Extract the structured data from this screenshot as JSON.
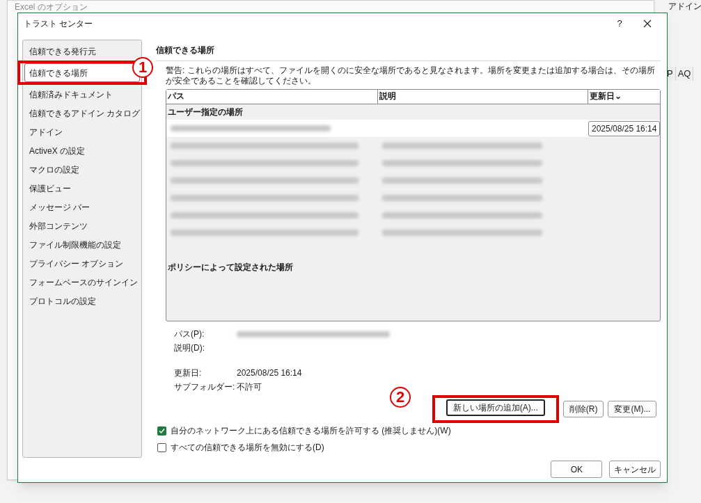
{
  "background": {
    "window_title": "Excel のオプション",
    "ribbon_label": "アドイン",
    "column_headers": [
      "P",
      "AQ"
    ]
  },
  "window": {
    "title": "トラスト センター",
    "help": "?"
  },
  "sidebar": {
    "items": [
      {
        "label": "信頼できる発行元",
        "selected": false
      },
      {
        "label": "信頼できる場所",
        "selected": true
      },
      {
        "label": "信頼済みドキュメント",
        "selected": false
      },
      {
        "label": "信頼できるアドイン カタログ",
        "selected": false
      },
      {
        "label": "アドイン",
        "selected": false
      },
      {
        "label": "ActiveX の設定",
        "selected": false
      },
      {
        "label": "マクロの設定",
        "selected": false
      },
      {
        "label": "保護ビュー",
        "selected": false
      },
      {
        "label": "メッセージ バー",
        "selected": false
      },
      {
        "label": "外部コンテンツ",
        "selected": false
      },
      {
        "label": "ファイル制限機能の設定",
        "selected": false
      },
      {
        "label": "プライバシー オプション",
        "selected": false
      },
      {
        "label": "フォームベースのサインイン",
        "selected": false
      },
      {
        "label": "プロトコルの設定",
        "selected": false
      }
    ]
  },
  "section": {
    "title": "信頼できる場所",
    "warning": "警告: これらの場所はすべて、ファイルを開くのに安全な場所であると見なされます。場所を変更または追加する場合は、その場所が安全であることを確認してください。"
  },
  "table": {
    "columns": [
      "パス",
      "説明",
      "更新日"
    ],
    "sort_indicator": "⌄",
    "groups": [
      {
        "title": "ユーザー指定の場所",
        "rows": [
          {
            "selected": true,
            "blurred_description": false,
            "modified": "2025/08/25 16:14"
          },
          {
            "selected": false,
            "blurred_description": true
          },
          {
            "selected": false,
            "blurred_description": true
          },
          {
            "selected": false,
            "blurred_description": true
          },
          {
            "selected": false,
            "blurred_description": true
          },
          {
            "selected": false,
            "blurred_description": true
          },
          {
            "selected": false,
            "blurred_description": true
          }
        ]
      },
      {
        "title": "ポリシーによって設定された場所"
      }
    ]
  },
  "details": [
    {
      "label": "パス(P):",
      "value_blurred": true
    },
    {
      "label": "説明(D):"
    },
    {
      "label": "更新日:",
      "value": "2025/08/25 16:14"
    },
    {
      "label": "サブフォルダー:",
      "value": "不許可"
    }
  ],
  "buttons": [
    {
      "label": "新しい場所の追加(A)...",
      "focused": true
    },
    {
      "label": "削除(R)",
      "focused": false
    },
    {
      "label": "変更(M)...",
      "focused": false
    }
  ],
  "checkboxes": [
    {
      "label": "自分のネットワーク上にある信頼できる場所を許可する (推奨しません)(W)",
      "checked": true
    },
    {
      "label": "すべての信頼できる場所を無効にする(D)",
      "checked": false
    }
  ],
  "footer_buttons": [
    "OK",
    "キャンセル"
  ],
  "annotations": [
    {
      "number": "1"
    },
    {
      "number": "2"
    }
  ]
}
